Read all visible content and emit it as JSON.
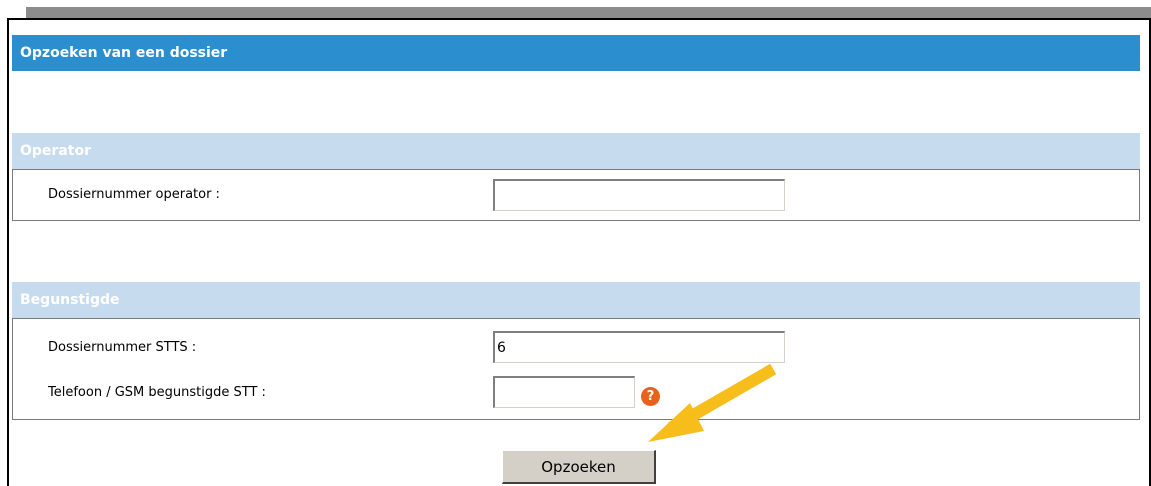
{
  "page": {
    "title": "Opzoeken van een dossier"
  },
  "operator_section": {
    "header": "Operator",
    "fields": [
      {
        "label": "Dossiernummer operator :",
        "value": ""
      }
    ]
  },
  "beneficiary_section": {
    "header": "Begunstigde",
    "fields": [
      {
        "label": "Dossiernummer STTS :",
        "value": "6"
      },
      {
        "label": "Telefoon / GSM begunstigde STT :",
        "value": ""
      }
    ],
    "help_icon": "question-mark-icon"
  },
  "actions": {
    "search_label": "Opzoeken"
  },
  "annotation": {
    "arrow_icon": "arrow-icon"
  },
  "colors": {
    "title_bar": "#2b8fcf",
    "section_header": "#c6dcee",
    "help_icon": "#e8621c",
    "arrow": "#f7bd1b",
    "button": "#d4d0c8"
  }
}
